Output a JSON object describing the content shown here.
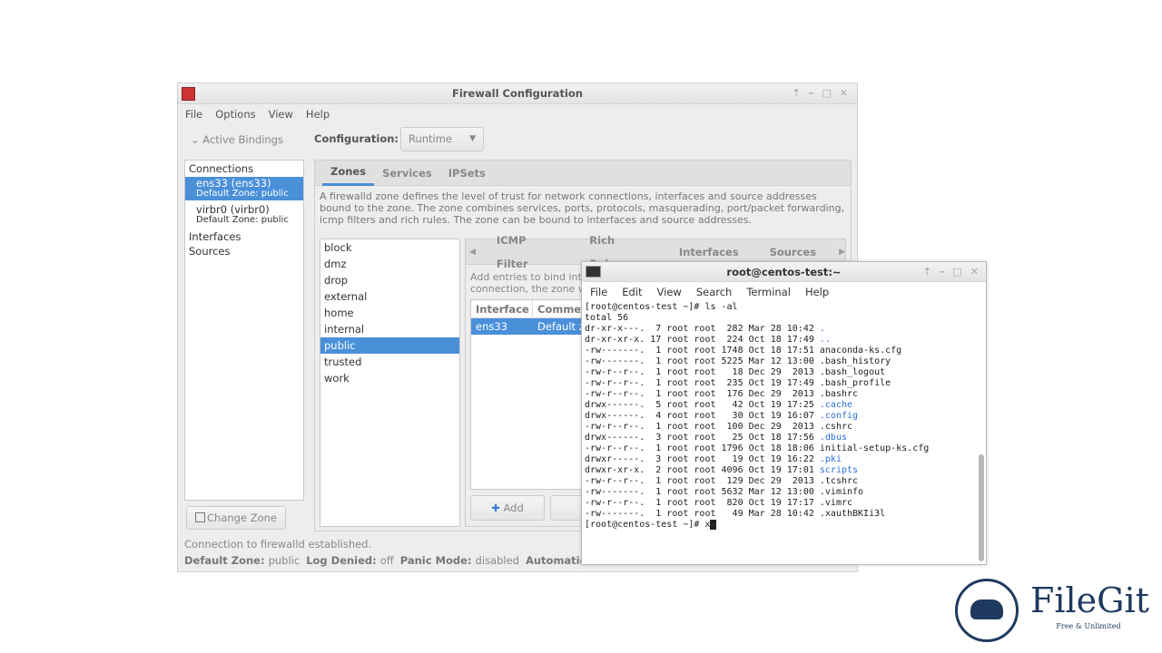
{
  "firewall": {
    "title": "Firewall Configuration",
    "menu": [
      "File",
      "Options",
      "View",
      "Help"
    ],
    "active_bindings": "Active Bindings",
    "config_label": "Configuration:",
    "config_value": "Runtime",
    "bindings": {
      "connections": "Connections",
      "items": [
        {
          "name": "ens33 (ens33)",
          "zone": "Default Zone: public",
          "selected": true
        },
        {
          "name": "virbr0 (virbr0)",
          "zone": "Default Zone: public",
          "selected": false
        }
      ],
      "interfaces": "Interfaces",
      "sources": "Sources"
    },
    "change_zone": "Change Zone",
    "tabs": [
      "Zones",
      "Services",
      "IPSets"
    ],
    "description": "A firewalld zone defines the level of trust for network connections, interfaces and source addresses bound to the zone. The zone combines services, ports, protocols, masquerading, port/packet forwarding, icmp filters and rich rules. The zone can be bound to interfaces and source addresses.",
    "zones": [
      "block",
      "dmz",
      "drop",
      "external",
      "home",
      "internal",
      "public",
      "trusted",
      "work"
    ],
    "selected_zone": "public",
    "subtabs": [
      "ICMP Filter",
      "Rich Rules",
      "Interfaces",
      "Sources"
    ],
    "sub_desc": "Add entries to bind int\nconnection, the zone w",
    "columns": [
      "Interface",
      "Comme"
    ],
    "rows": [
      [
        "ens33",
        "Default zo"
      ]
    ],
    "add": "Add",
    "status": "Connection to firewalld established.",
    "status_fields": [
      {
        "k": "Default Zone:",
        "v": "public"
      },
      {
        "k": "Log Denied:",
        "v": "off"
      },
      {
        "k": "Panic Mode:",
        "v": "disabled"
      },
      {
        "k": "Automatic H",
        "v": ""
      }
    ]
  },
  "terminal": {
    "title": "root@centos-test:~",
    "menu": [
      "File",
      "Edit",
      "View",
      "Search",
      "Terminal",
      "Help"
    ],
    "prompt": "[root@centos-test ~]# ",
    "command": "ls -al",
    "total": "total 56",
    "entries": [
      [
        "dr-xr-x---.  7 root root  282 Mar 28 10:42 ",
        ".",
        true
      ],
      [
        "dr-xr-xr-x. 17 root root  224 Oct 18 17:49 ",
        "..",
        true
      ],
      [
        "-rw-------.  1 root root 1748 Oct 18 17:51 ",
        "anaconda-ks.cfg",
        false
      ],
      [
        "-rw-------.  1 root root 5225 Mar 12 13:00 ",
        ".bash_history",
        false
      ],
      [
        "-rw-r--r--.  1 root root   18 Dec 29  2013 ",
        ".bash_logout",
        false
      ],
      [
        "-rw-r--r--.  1 root root  235 Oct 19 17:49 ",
        ".bash_profile",
        false
      ],
      [
        "-rw-r--r--.  1 root root  176 Dec 29  2013 ",
        ".bashrc",
        false
      ],
      [
        "drwx------.  5 root root   42 Oct 19 17:25 ",
        ".cache",
        true
      ],
      [
        "drwx------.  4 root root   30 Oct 19 16:07 ",
        ".config",
        true
      ],
      [
        "-rw-r--r--.  1 root root  100 Dec 29  2013 ",
        ".cshrc",
        false
      ],
      [
        "drwx------.  3 root root   25 Oct 18 17:56 ",
        ".dbus",
        true
      ],
      [
        "-rw-r--r--.  1 root root 1796 Oct 18 18:06 ",
        "initial-setup-ks.cfg",
        false
      ],
      [
        "drwxr-----.  3 root root   19 Oct 19 16:22 ",
        ".pki",
        true
      ],
      [
        "drwxr-xr-x.  2 root root 4096 Oct 19 17:01 ",
        "scripts",
        true
      ],
      [
        "-rw-r--r--.  1 root root  129 Dec 29  2013 ",
        ".tcshrc",
        false
      ],
      [
        "-rw-------.  1 root root 5632 Mar 12 13:00 ",
        ".viminfo",
        false
      ],
      [
        "-rw-r--r--.  1 root root  820 Oct 19 17:17 ",
        ".vimrc",
        false
      ],
      [
        "-rw-------.  1 root root   49 Mar 28 10:42 ",
        ".xauthBKIi3l",
        false
      ]
    ],
    "typed": "x",
    "dir_color": "#2a6fd6"
  },
  "watermark": {
    "brand": "FileGit",
    "tagline": "Free & Unlimited"
  }
}
